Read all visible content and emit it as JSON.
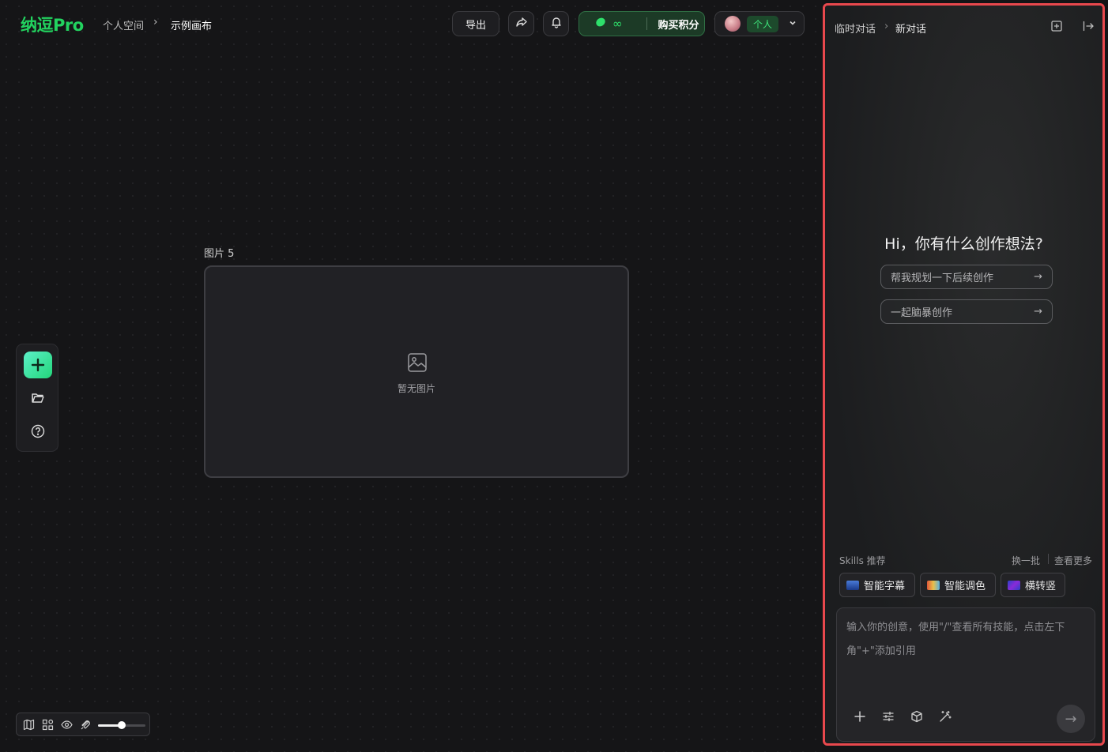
{
  "app": {
    "logo": "纳逗Pro"
  },
  "breadcrumb": {
    "space": "个人空间",
    "separator": "›",
    "canvas": "示例画布"
  },
  "header": {
    "export_label": "导出",
    "share_icon": "share-icon",
    "bell_icon": "bell-icon",
    "credits_symbol": "∞",
    "buy_label": "购买积分",
    "account_tag": "个人"
  },
  "node": {
    "title": "图片 5",
    "empty_text": "暂无图片"
  },
  "bottom_toolbar": {
    "zoom_fraction": 0.5
  },
  "panel": {
    "breadcrumb_root": "临时对话",
    "breadcrumb_sep": "›",
    "breadcrumb_current": "新对话",
    "greeting": "Hi，你有什么创作想法?",
    "suggestions": [
      {
        "label": "帮我规划一下后续创作",
        "arrow": "→"
      },
      {
        "label": "一起脑暴创作",
        "arrow": "→"
      }
    ],
    "skills_label": "Skills 推荐",
    "refresh_label": "换一批",
    "more_label": "查看更多",
    "skills": [
      {
        "label": "智能字幕"
      },
      {
        "label": "智能调色"
      },
      {
        "label": "横转竖"
      }
    ],
    "composer_placeholder": "输入你的创意，使用\"/\"查看所有技能，点击左下角\"+\"添加引用",
    "send_icon": "→"
  },
  "colors": {
    "brand_green": "#22d35f",
    "panel_highlight": "#e8484d"
  }
}
